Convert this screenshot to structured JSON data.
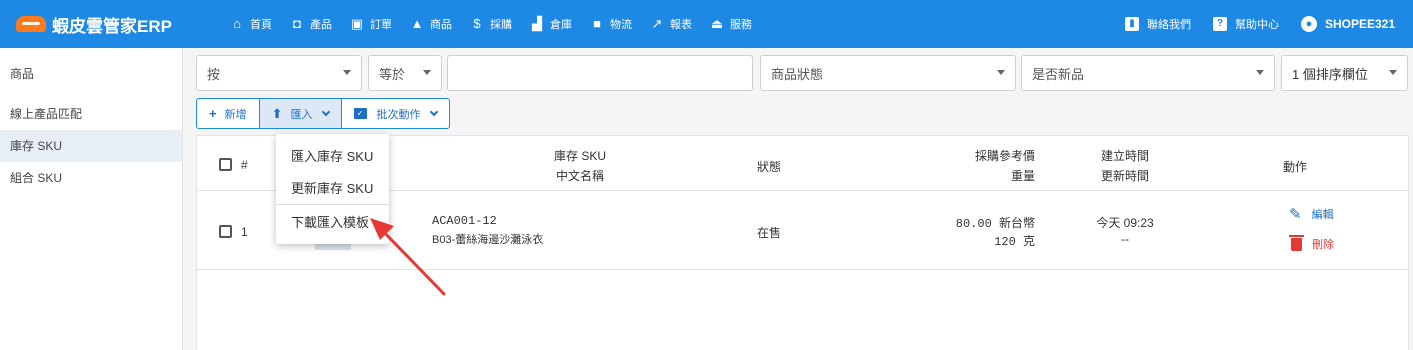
{
  "app": {
    "title": "蝦皮雲管家ERP",
    "brand_color": "#1e88e5",
    "nav": [
      {
        "label": "首頁",
        "icon": "home-icon",
        "glyph": "⌂"
      },
      {
        "label": "產品",
        "icon": "bag-icon",
        "glyph": "◘"
      },
      {
        "label": "訂單",
        "icon": "cart-icon",
        "glyph": "🛒"
      },
      {
        "label": "商品",
        "icon": "shapes-icon",
        "glyph": "▲"
      },
      {
        "label": "採購",
        "icon": "dollar-icon",
        "glyph": "$"
      },
      {
        "label": "倉庫",
        "icon": "warehouse-icon",
        "glyph": "▟"
      },
      {
        "label": "物流",
        "icon": "truck-icon",
        "glyph": "⛟"
      },
      {
        "label": "報表",
        "icon": "chart-icon",
        "glyph": "↗"
      },
      {
        "label": "服務",
        "icon": "eject-icon",
        "glyph": "⏏"
      }
    ],
    "contact_label": "聯絡我們",
    "help_label": "幫助中心",
    "user_name": "SHOPEE321"
  },
  "sidebar": {
    "items": [
      {
        "label": "商品"
      },
      {
        "label": "線上產品匹配"
      },
      {
        "label": "庫存 SKU"
      },
      {
        "label": "組合 SKU"
      }
    ]
  },
  "filters": {
    "field": "按",
    "operator": "等於",
    "value": "",
    "status_placeholder": "商品狀態",
    "is_new_placeholder": "是否新品",
    "sort": "1 個排序欄位"
  },
  "toolbar": {
    "add_label": "新增",
    "import_label": "匯入",
    "batch_label": "批次動作"
  },
  "import_menu": {
    "items": [
      "匯入庫存 SKU",
      "更新庫存 SKU",
      "下載匯入模板"
    ]
  },
  "table": {
    "headers": {
      "index": "#",
      "sku": "庫存 SKU",
      "chinese_name": "中文名稱",
      "status": "狀態",
      "purchase_price": "採購參考價",
      "weight": "重量",
      "created": "建立時間",
      "updated": "更新時間",
      "actions": "動作"
    },
    "rows": [
      {
        "index": "1",
        "sku": "ACA001-12",
        "name": "B03-蕾絲海邊沙灘泳衣",
        "status": "在售",
        "price": "80.00 新台幣",
        "weight": "120 克",
        "created": "今天 09:23",
        "updated": "--",
        "edit_label": "編輯",
        "delete_label": "刪除"
      }
    ]
  },
  "colors": {
    "accent": "#1e88e5",
    "danger": "#e53935",
    "annotation": "#e53935"
  }
}
